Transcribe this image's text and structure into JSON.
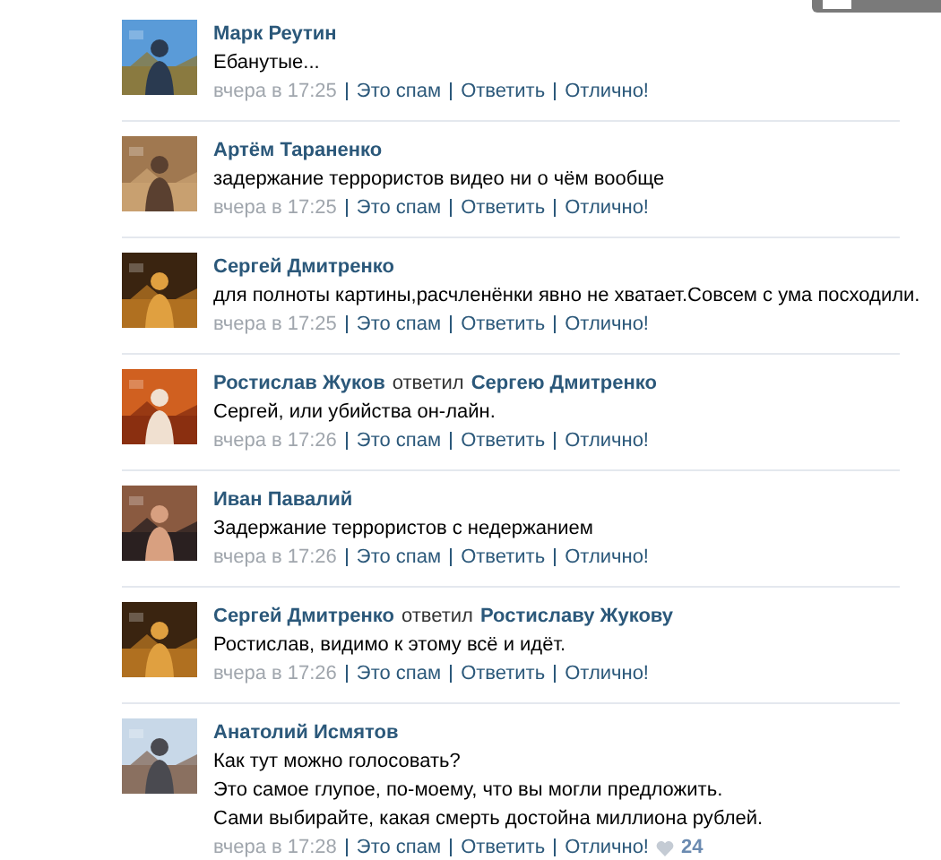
{
  "comments": [
    {
      "author": "Марк Реутин",
      "text": [
        "Ебанутые..."
      ],
      "time": "вчера в 17:25",
      "actions": [
        "Это спам",
        "Ответить",
        "Отлично!"
      ]
    },
    {
      "author": "Артём Тараненко",
      "text": [
        "задержание террористов видео ни о чём вообще"
      ],
      "time": "вчера в 17:25",
      "actions": [
        "Это спам",
        "Ответить",
        "Отлично!"
      ]
    },
    {
      "author": "Сергей Дмитренко",
      "text": [
        "для полноты картины,расчленёнки явно не хватает.Совсем с ума посходили."
      ],
      "time": "вчера в 17:25",
      "actions": [
        "Это спам",
        "Ответить",
        "Отлично!"
      ]
    },
    {
      "author": "Ростислав Жуков",
      "reply_verb": "ответил",
      "reply_to": "Сергею Дмитренко",
      "text": [
        "Сергей, или убийства он-лайн."
      ],
      "time": "вчера в 17:26",
      "actions": [
        "Это спам",
        "Ответить",
        "Отлично!"
      ]
    },
    {
      "author": "Иван Павалий",
      "text": [
        "Задержание террористов с недержанием"
      ],
      "time": "вчера в 17:26",
      "actions": [
        "Это спам",
        "Ответить",
        "Отлично!"
      ]
    },
    {
      "author": "Сергей Дмитренко",
      "reply_verb": "ответил",
      "reply_to": "Ростиславу Жукову",
      "text": [
        "Ростислав, видимо к этому всё и идёт."
      ],
      "time": "вчера в 17:26",
      "actions": [
        "Это спам",
        "Ответить",
        "Отлично!"
      ]
    },
    {
      "author": "Анатолий Исмятов",
      "text": [
        "Как тут можно голосовать?",
        "Это самое глупое, по-моему, что вы могли предложить.",
        "Сами выбирайте, какая смерть достойна миллиона рублей."
      ],
      "time": "вчера в 17:28",
      "actions": [
        "Это спам",
        "Ответить",
        "Отлично!"
      ],
      "likes": "24"
    }
  ]
}
